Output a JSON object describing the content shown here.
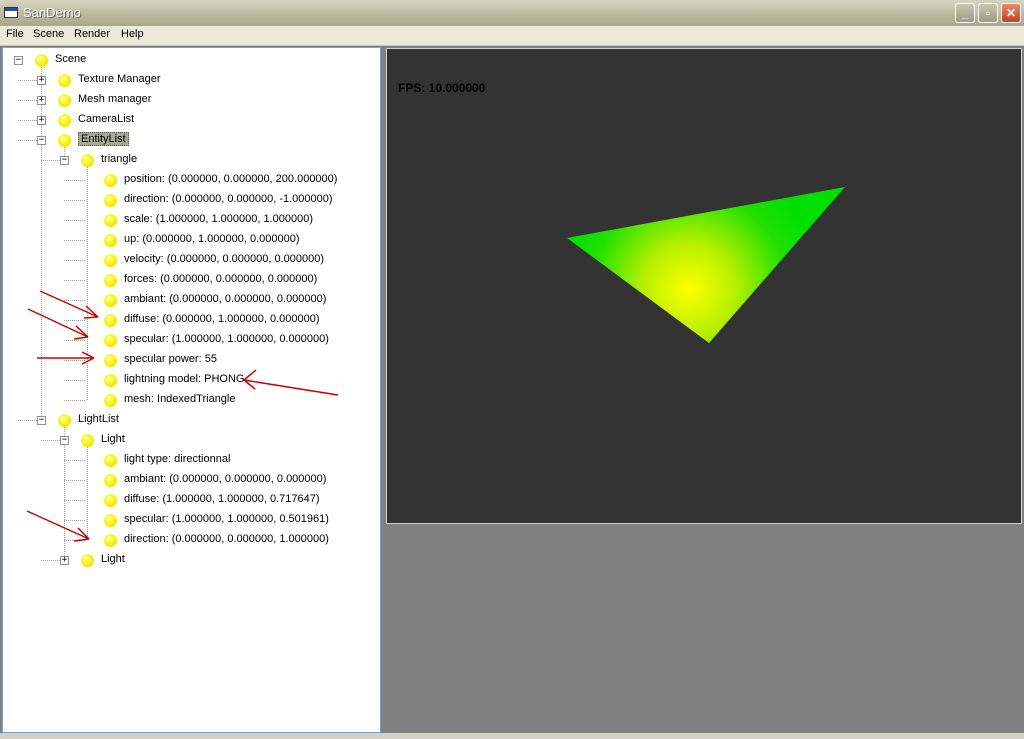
{
  "window": {
    "title": "SanDemo"
  },
  "menu": [
    "File",
    "Scene",
    "Render",
    "Help"
  ],
  "tree": [
    {
      "label": "Scene",
      "level": 0,
      "expander": "minus"
    },
    {
      "label": "Texture Manager",
      "level": 1,
      "expander": "plus"
    },
    {
      "label": "Mesh manager",
      "level": 1,
      "expander": "plus"
    },
    {
      "label": "CameraList",
      "level": 1,
      "expander": "plus"
    },
    {
      "label": "EntityList",
      "level": 1,
      "expander": "minus",
      "selected": true
    },
    {
      "label": "triangle",
      "level": 2,
      "expander": "minus"
    },
    {
      "label": "position: (0.000000, 0.000000, 200.000000)",
      "level": 3
    },
    {
      "label": "direction: (0.000000, 0.000000, -1.000000)",
      "level": 3
    },
    {
      "label": "scale: (1.000000, 1.000000, 1.000000)",
      "level": 3
    },
    {
      "label": "up: (0.000000, 1.000000, 0.000000)",
      "level": 3
    },
    {
      "label": "velocity: (0.000000, 0.000000, 0.000000)",
      "level": 3
    },
    {
      "label": "forces: (0.000000, 0.000000, 0.000000)",
      "level": 3
    },
    {
      "label": "ambiant: (0.000000, 0.000000, 0.000000)",
      "level": 3
    },
    {
      "label": "diffuse: (0.000000, 1.000000, 0.000000)",
      "level": 3
    },
    {
      "label": "specular: (1.000000, 1.000000, 0.000000)",
      "level": 3
    },
    {
      "label": "specular power: 55",
      "level": 3
    },
    {
      "label": "lightning model: PHONG",
      "level": 3
    },
    {
      "label": "mesh: IndexedTriangle",
      "level": 3
    },
    {
      "label": "LightList",
      "level": 1,
      "expander": "minus"
    },
    {
      "label": "Light",
      "level": 2,
      "expander": "minus"
    },
    {
      "label": "light type: directionnal",
      "level": 3
    },
    {
      "label": "ambiant: (0.000000, 0.000000, 0.000000)",
      "level": 3
    },
    {
      "label": "diffuse: (1.000000, 1.000000, 0.717647)",
      "level": 3
    },
    {
      "label": "specular: (1.000000, 1.000000, 0.501961)",
      "level": 3
    },
    {
      "label": "direction: (0.000000, 0.000000, 1.000000)",
      "level": 3
    },
    {
      "label": "Light",
      "level": 2,
      "expander": "plus"
    }
  ],
  "viewport": {
    "fps": "FPS: 10.000000"
  },
  "colors": {
    "viewport_bg": "#333333",
    "triangle_edge": "#00ff00",
    "triangle_hotspot": "#ffff00",
    "annotation_arrow": "#cc0000"
  }
}
